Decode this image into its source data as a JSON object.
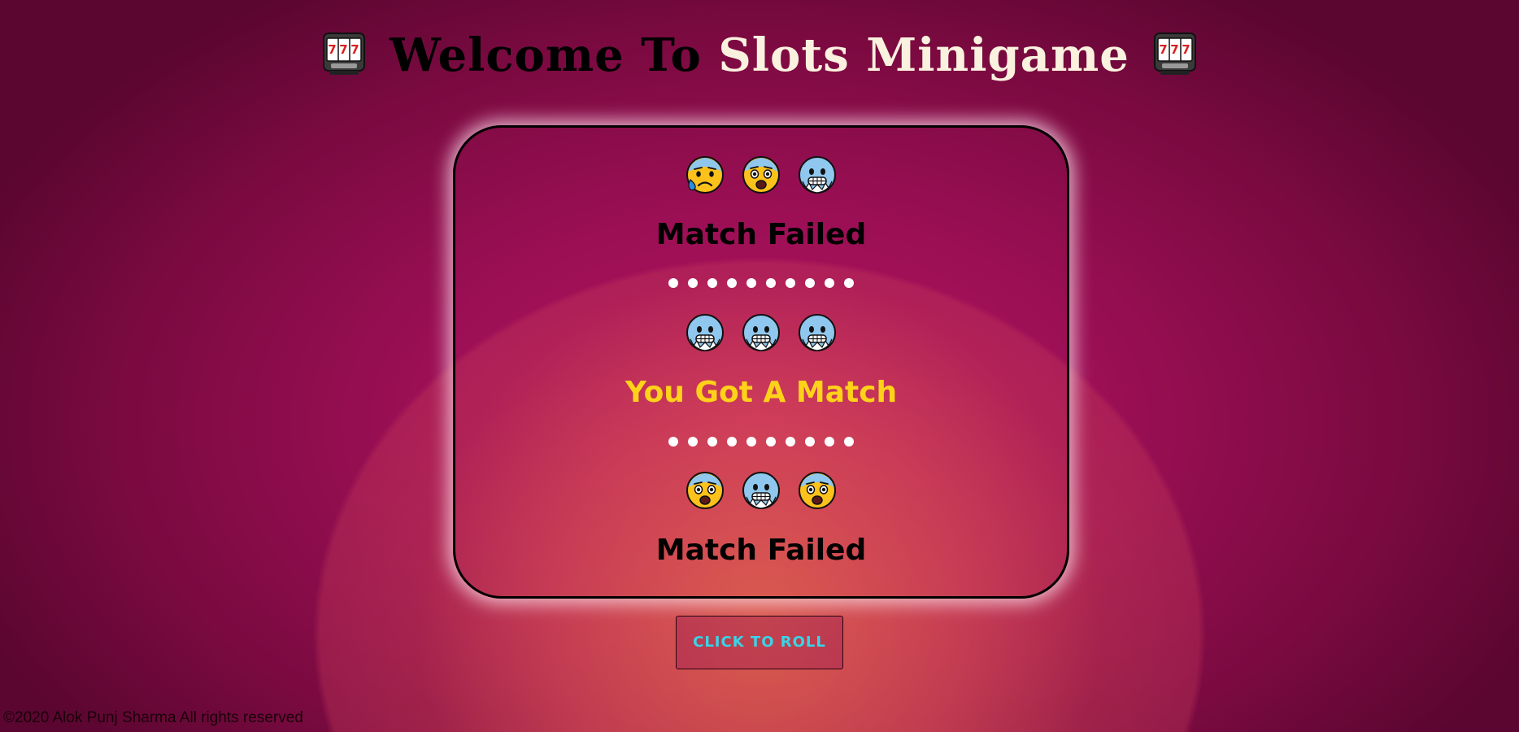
{
  "header": {
    "title_part1": "Welcome To",
    "title_part2": "Slots Minigame",
    "icon": "slot-machine-icon"
  },
  "rows": [
    {
      "emojis": [
        "anxious-face-with-sweat",
        "fearful-face",
        "cold-face"
      ],
      "result": "Match Failed",
      "status": "fail"
    },
    {
      "emojis": [
        "cold-face",
        "cold-face",
        "cold-face"
      ],
      "result": "You Got A Match",
      "status": "win"
    },
    {
      "emojis": [
        "fearful-face",
        "cold-face",
        "fearful-face"
      ],
      "result": "Match Failed",
      "status": "fail"
    }
  ],
  "separator": "●●●●●●●●●●",
  "roll_button": {
    "label": "CLICK TO ROLL"
  },
  "footer": {
    "text": "©2020 Alok Punj Sharma All rights reserved"
  },
  "colors": {
    "win_text": "#ffd21a",
    "fail_text": "#000000",
    "button_text": "#37d5e8",
    "title_light": "#fbf1df"
  }
}
